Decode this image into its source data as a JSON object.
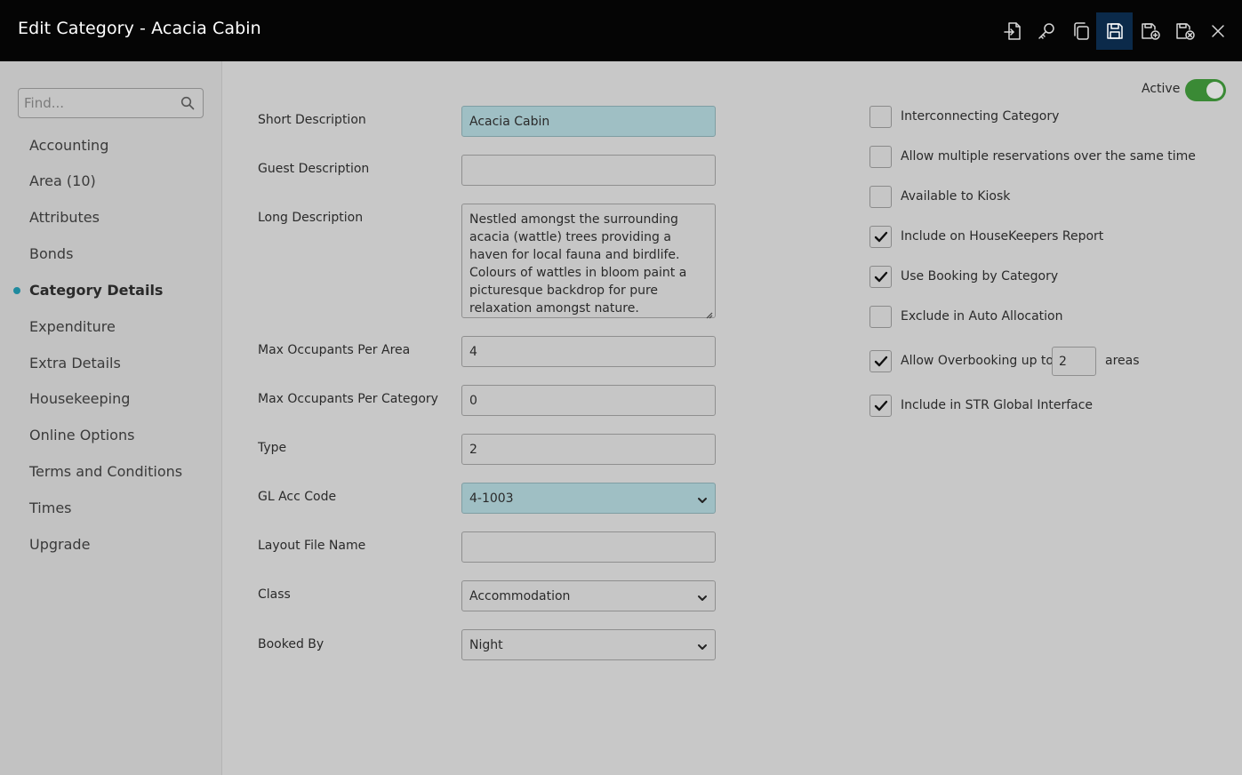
{
  "window": {
    "title": "Edit Category - Acacia Cabin"
  },
  "toolbar": {
    "buttons": [
      {
        "icon": "export-icon"
      },
      {
        "icon": "key-icon"
      },
      {
        "icon": "copy-icon"
      },
      {
        "icon": "save-icon",
        "active": true
      },
      {
        "icon": "save-and-new-icon"
      },
      {
        "icon": "save-and-close-icon"
      },
      {
        "icon": "close-icon"
      }
    ]
  },
  "sidebar": {
    "search_placeholder": "Find...",
    "items": [
      {
        "label": "Accounting"
      },
      {
        "label": "Area (10)"
      },
      {
        "label": "Attributes"
      },
      {
        "label": "Bonds"
      },
      {
        "label": "Category Details",
        "active": true
      },
      {
        "label": "Expenditure"
      },
      {
        "label": "Extra Details"
      },
      {
        "label": "Housekeeping"
      },
      {
        "label": "Online Options"
      },
      {
        "label": "Terms and Conditions"
      },
      {
        "label": "Times"
      },
      {
        "label": "Upgrade"
      }
    ]
  },
  "form": {
    "short_description": {
      "label": "Short Description",
      "value": "Acacia Cabin"
    },
    "guest_description": {
      "label": "Guest Description",
      "value": ""
    },
    "long_description": {
      "label": "Long Description",
      "value": "Nestled amongst the surrounding acacia (wattle) trees providing a haven for local fauna and birdlife. Colours of wattles in bloom paint a picturesque backdrop for pure relaxation amongst nature."
    },
    "max_occupants_area": {
      "label": "Max Occupants Per Area",
      "value": "4"
    },
    "max_occupants_category": {
      "label": "Max Occupants Per Category",
      "value": "0"
    },
    "type": {
      "label": "Type",
      "value": "2"
    },
    "gl_acc_code": {
      "label": "GL Acc Code",
      "value": "4-1003"
    },
    "layout_file_name": {
      "label": "Layout File Name",
      "value": ""
    },
    "class": {
      "label": "Class",
      "value": "Accommodation"
    },
    "booked_by": {
      "label": "Booked By",
      "value": "Night"
    }
  },
  "options": {
    "active": {
      "label": "Active",
      "on": true
    },
    "checkboxes": [
      {
        "label": "Interconnecting Category",
        "checked": false
      },
      {
        "label": "Allow multiple reservations over the same time",
        "checked": false
      },
      {
        "label": "Available to Kiosk",
        "checked": false
      },
      {
        "label": "Include on HouseKeepers Report",
        "checked": true
      },
      {
        "label": "Use Booking by Category",
        "checked": true
      },
      {
        "label": "Exclude in Auto Allocation",
        "checked": false
      },
      {
        "label": "Allow Overbooking up to",
        "checked": true
      },
      {
        "label": "Include in STR Global Interface",
        "checked": true
      }
    ],
    "overbooking_value": "2",
    "overbooking_suffix": "areas"
  },
  "colors": {
    "header_bg": "#050505",
    "accent": "#1f8a9e",
    "highlight_field": "#9fbfc4",
    "toggle_on": "#3a8a35"
  }
}
